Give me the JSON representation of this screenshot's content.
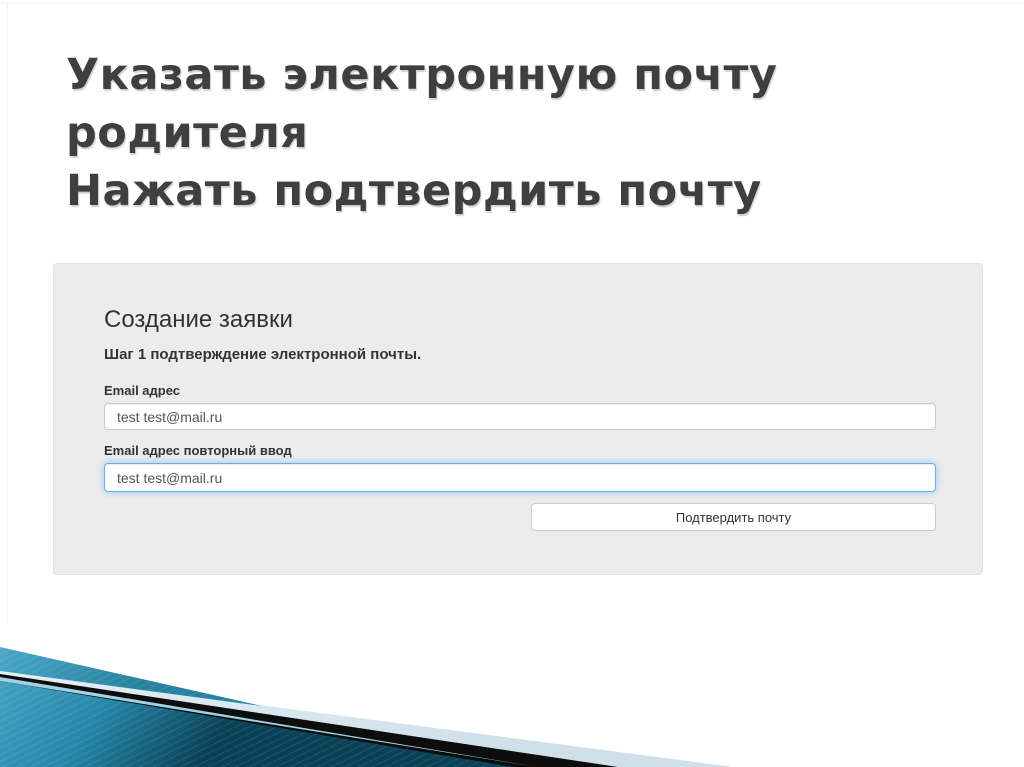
{
  "slide": {
    "title_lines": [
      "Указать электронную почту",
      "родителя",
      "Нажать подтвердить почту"
    ]
  },
  "form": {
    "heading": "Создание заявки",
    "subheading": "Шаг 1 подтверждение электронной почты.",
    "fields": [
      {
        "label": "Email адрес",
        "value": "test test@mail.ru",
        "focused": false
      },
      {
        "label": "Email адрес повторный ввод",
        "value": "test test@mail.ru",
        "focused": true
      }
    ],
    "submit_label": "Подтвердить почту"
  },
  "colors": {
    "title_text": "#3e3f41",
    "card_background": "#ececec",
    "input_border": "#cccccc",
    "focus_border": "#66afe9",
    "input_text": "#555555",
    "label_text": "#333333",
    "ribbon_teal_light": "#47a5c4",
    "ribbon_teal_dark": "#0b4156",
    "ribbon_pale_blue": "#d9e6ef",
    "ribbon_black": "#0d0d0d"
  }
}
